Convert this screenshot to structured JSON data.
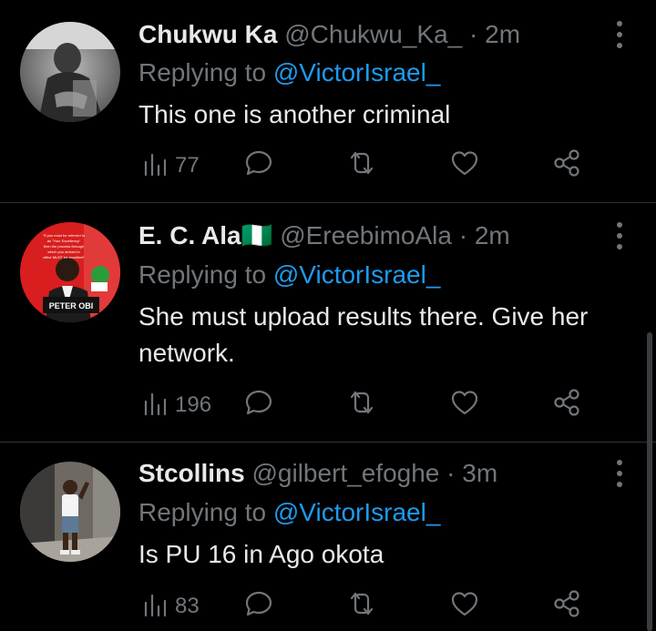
{
  "tweets": [
    {
      "name": "Chukwu Ka",
      "handle": "@Chukwu_Ka_",
      "time": "· 2m",
      "replying_prefix": "Replying to",
      "replying_to": "@VictorIsrael_",
      "text": "This one is another criminal",
      "views": "77"
    },
    {
      "name": "E. C. Ala🇳🇬",
      "handle": "@EreebimoAla",
      "time": "· 2m",
      "replying_prefix": "Replying to",
      "replying_to": "@VictorIsrael_",
      "text": "She must upload results there. Give her network.",
      "views": "196",
      "avatar_caption": "PETER OBI",
      "avatar_poster_text": "\"If you must be referred to as \"Your Excellency\" then the process through which you arrived in office MUST be excellent\""
    },
    {
      "name": "Stcollins",
      "handle": "@gilbert_efoghe",
      "time": "· 3m",
      "replying_prefix": "Replying to",
      "replying_to": "@VictorIsrael_",
      "text": "Is PU 16 in Ago okota",
      "views": "83"
    }
  ],
  "colors": {
    "background": "#000000",
    "text": "#e7e9ea",
    "muted": "#71767b",
    "link": "#1d9bf0",
    "divider": "#2f3336"
  }
}
